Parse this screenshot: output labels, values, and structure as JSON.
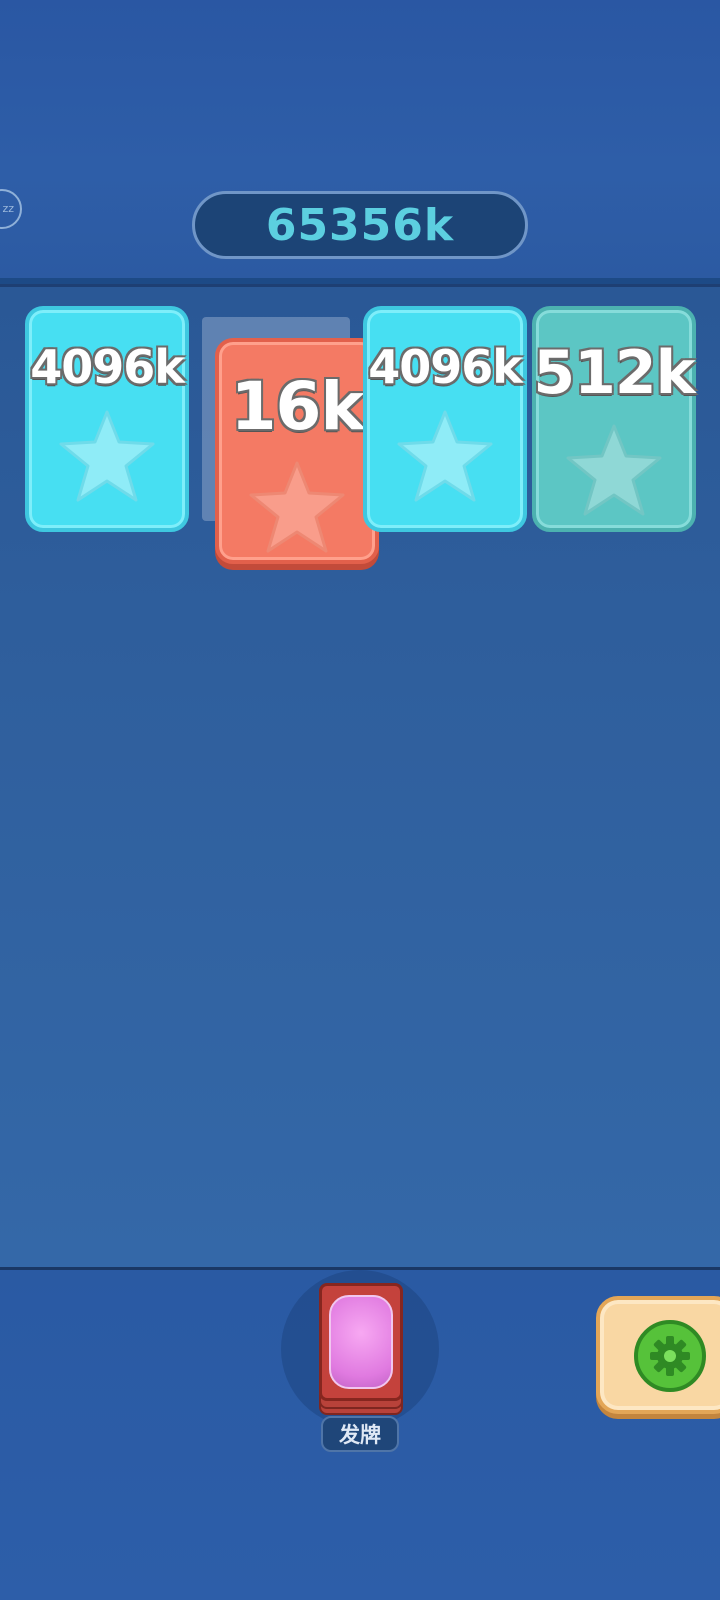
{
  "header": {
    "score": "65356k",
    "left_badge": "zz"
  },
  "cards": [
    {
      "value": "4096k",
      "color": "#47dff2",
      "icon": "star-icon"
    },
    {
      "value": "16k",
      "color": "#f47a64",
      "icon": "star-icon",
      "state": "lifted"
    },
    {
      "value": "4096k",
      "color": "#47dff2",
      "icon": "star-icon"
    },
    {
      "value": "512k",
      "color": "#5cc6c4",
      "icon": "star-icon"
    }
  ],
  "footer": {
    "deal_label": "发牌",
    "deal_icon": "card-deck-icon",
    "settings_icon": "gear-icon"
  },
  "colors": {
    "background": "#2e5c9a",
    "score_text": "#5ccfe0",
    "card_cyan": "#47dff2",
    "card_teal": "#5cc6c4",
    "card_red": "#f47a64",
    "settings_button": "#f9d7a3",
    "gear": "#56c23a"
  }
}
